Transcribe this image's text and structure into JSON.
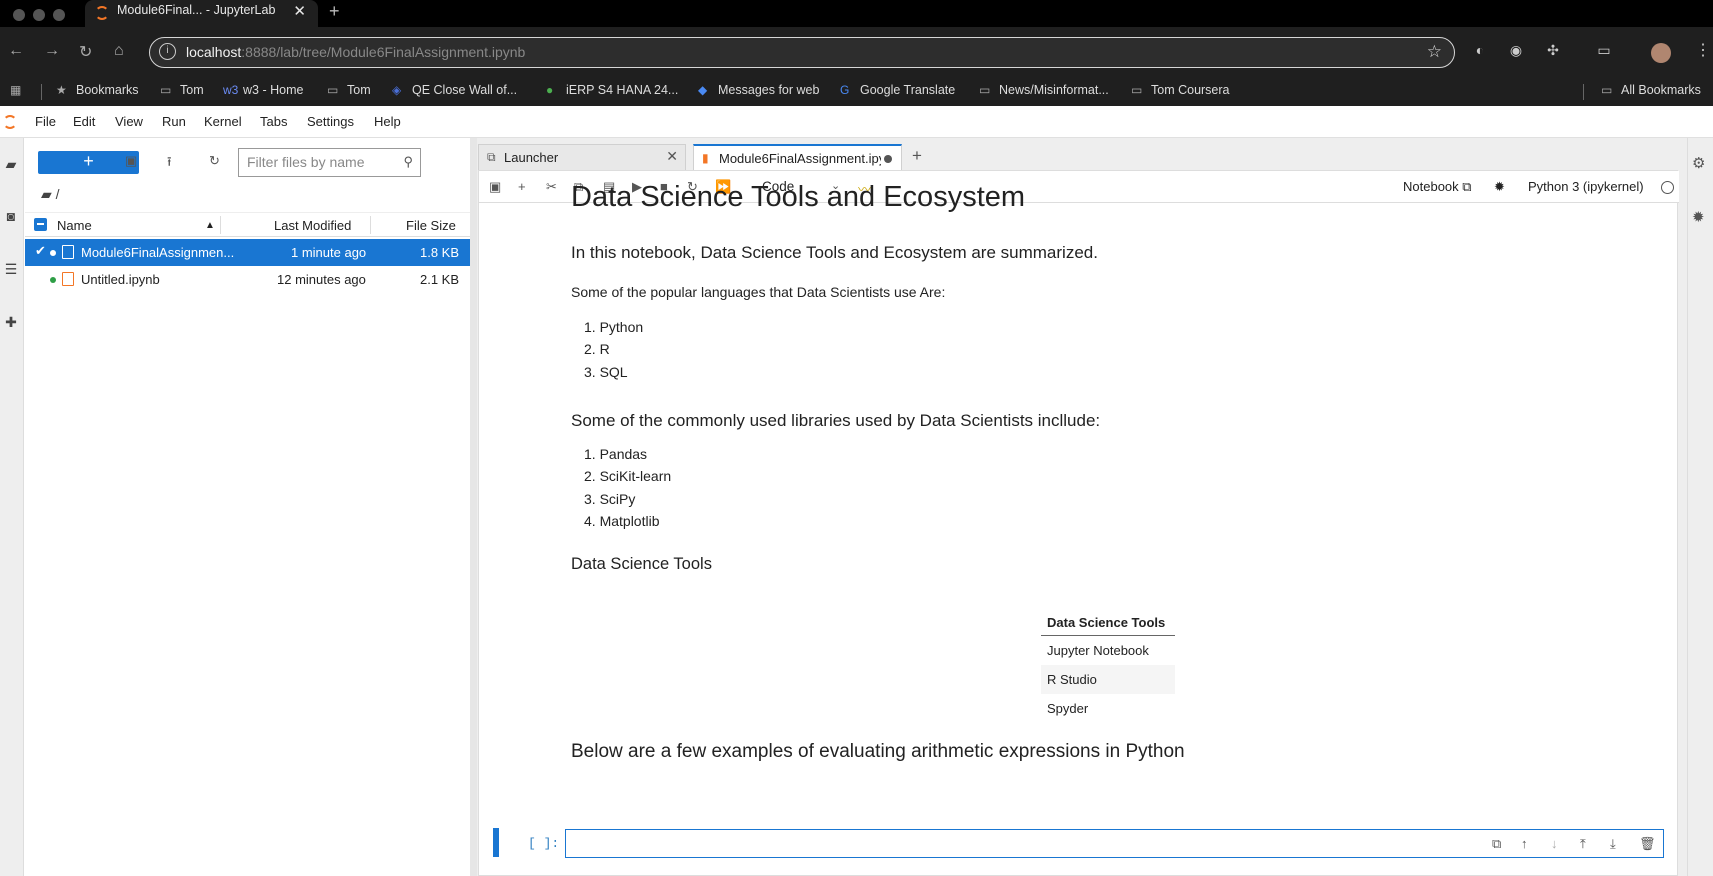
{
  "browser": {
    "tab_title": "Module6Final... - JupyterLab",
    "tab_close": "✕",
    "new_tab": "+",
    "url_host": "localhost",
    "url_rest": ":8888/lab/tree/Module6FinalAssignment.ipynb",
    "bookmarks": [
      {
        "label": "Bookmarks",
        "icon": "star-icon"
      },
      {
        "label": "Tom",
        "icon": "folder-icon"
      },
      {
        "label": "w3 - Home",
        "icon": "w3-icon"
      },
      {
        "label": "Tom",
        "icon": "folder-icon"
      },
      {
        "label": "QE Close Wall of...",
        "icon": "qe-icon"
      },
      {
        "label": "iERP S4 HANA 24...",
        "icon": "ierp-icon"
      },
      {
        "label": "Messages for web",
        "icon": "messages-icon"
      },
      {
        "label": "Google Translate",
        "icon": "translate-icon"
      },
      {
        "label": "News/Misinformat...",
        "icon": "folder-icon"
      },
      {
        "label": "Tom Coursera",
        "icon": "folder-icon"
      }
    ],
    "all_bookmarks": "All Bookmarks"
  },
  "menu": [
    "File",
    "Edit",
    "View",
    "Run",
    "Kernel",
    "Tabs",
    "Settings",
    "Help"
  ],
  "filebrowser": {
    "new_label": "+",
    "filter_placeholder": "Filter files by name",
    "breadcrumb": "/",
    "columns": {
      "name": "Name",
      "modified": "Last Modified",
      "size": "File Size"
    },
    "files": [
      {
        "name": "Module6FinalAssignmen...",
        "modified": "1 minute ago",
        "size": "1.8 KB",
        "selected": true
      },
      {
        "name": "Untitled.ipynb",
        "modified": "12 minutes ago",
        "size": "2.1 KB",
        "selected": false
      }
    ]
  },
  "tabs": [
    {
      "label": "Launcher"
    },
    {
      "label": "Module6FinalAssignment.ipynb"
    }
  ],
  "notebook_toolbar": {
    "cell_type": "Code",
    "notebook_label": "Notebook",
    "kernel": "Python 3 (ipykernel)"
  },
  "notebook": {
    "title": "Data Science Tools and Ecosystem",
    "intro": "In this notebook, Data Science Tools and Ecosystem are summarized.",
    "languages_intro": "Some of the popular languages that Data Scientists use Are:",
    "languages": [
      "1. Python",
      "2. R",
      "3. SQL"
    ],
    "libraries_heading": "Some of the commonly used libraries used by Data Scientists incllude:",
    "libraries": [
      "1. Pandas",
      "2. SciKit-learn",
      "3. SciPy",
      "4. Matplotlib"
    ],
    "tools_heading": "Data Science Tools",
    "tools_table": {
      "header": "Data Science Tools",
      "rows": [
        "Jupyter Notebook",
        "R Studio",
        "Spyder"
      ]
    },
    "arith_heading": "Below are a few examples of evaluating arithmetic expressions in Python",
    "cell_prompt": "[ ]:"
  },
  "colors": {
    "accent": "#1976d2",
    "jupyter_orange": "#f37626"
  }
}
